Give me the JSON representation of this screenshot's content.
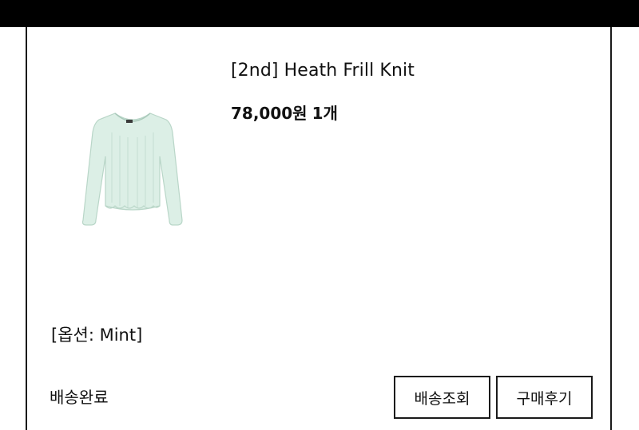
{
  "product": {
    "name": "[2nd] Heath Frill Knit",
    "price": "78,000원",
    "quantity": "1개",
    "option": "[옵션: Mint]",
    "image_icon": "mint-knit-top-image",
    "image_color": "#dcefe6"
  },
  "order": {
    "status": "배송완료"
  },
  "actions": {
    "track_label": "배송조회",
    "review_label": "구매후기"
  }
}
